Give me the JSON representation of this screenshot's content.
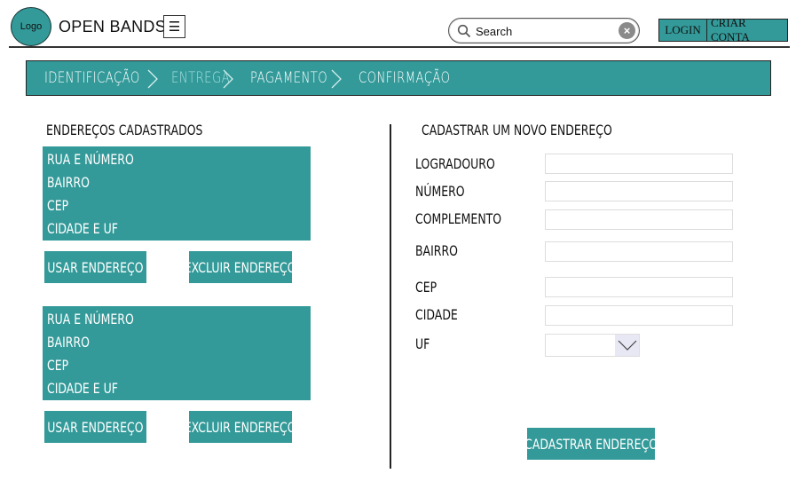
{
  "header": {
    "logo_text": "Logo",
    "brand": "OPEN BANDS",
    "menu_icon": "hamburger-icon",
    "search": {
      "placeholder": "Search",
      "value": ""
    },
    "login_label": "LOGIN",
    "signup_label": "CRIAR CONTA"
  },
  "steps": [
    {
      "label": "Identificação",
      "active": false
    },
    {
      "label": "Entrega",
      "active": true
    },
    {
      "label": "Pagamento",
      "active": false
    },
    {
      "label": "Confirmação",
      "active": false
    }
  ],
  "saved": {
    "title": "Endereços cadastrados",
    "cards": [
      {
        "lines": [
          "Rua e número",
          "Bairro",
          "CEP",
          "Cidade e UF"
        ],
        "use_label": "Usar endereço",
        "delete_label": "Excluir endereço"
      },
      {
        "lines": [
          "Rua e número",
          "Bairro",
          "CEP",
          "Cidade e UF"
        ],
        "use_label": "Usar endereço",
        "delete_label": "Excluir endereço"
      }
    ]
  },
  "new_address": {
    "title": "Cadastrar um novo endereço",
    "fields": {
      "logradouro": "Logradouro",
      "numero": "Número",
      "complemento": "Complemento",
      "bairro": "Bairro",
      "cep": "CEP",
      "cidade": "Cidade",
      "uf": "UF"
    },
    "uf_value": "",
    "submit_label": "Cadastrar endereço"
  },
  "colors": {
    "accent": "#339a99",
    "active_step": "#a8dede"
  }
}
